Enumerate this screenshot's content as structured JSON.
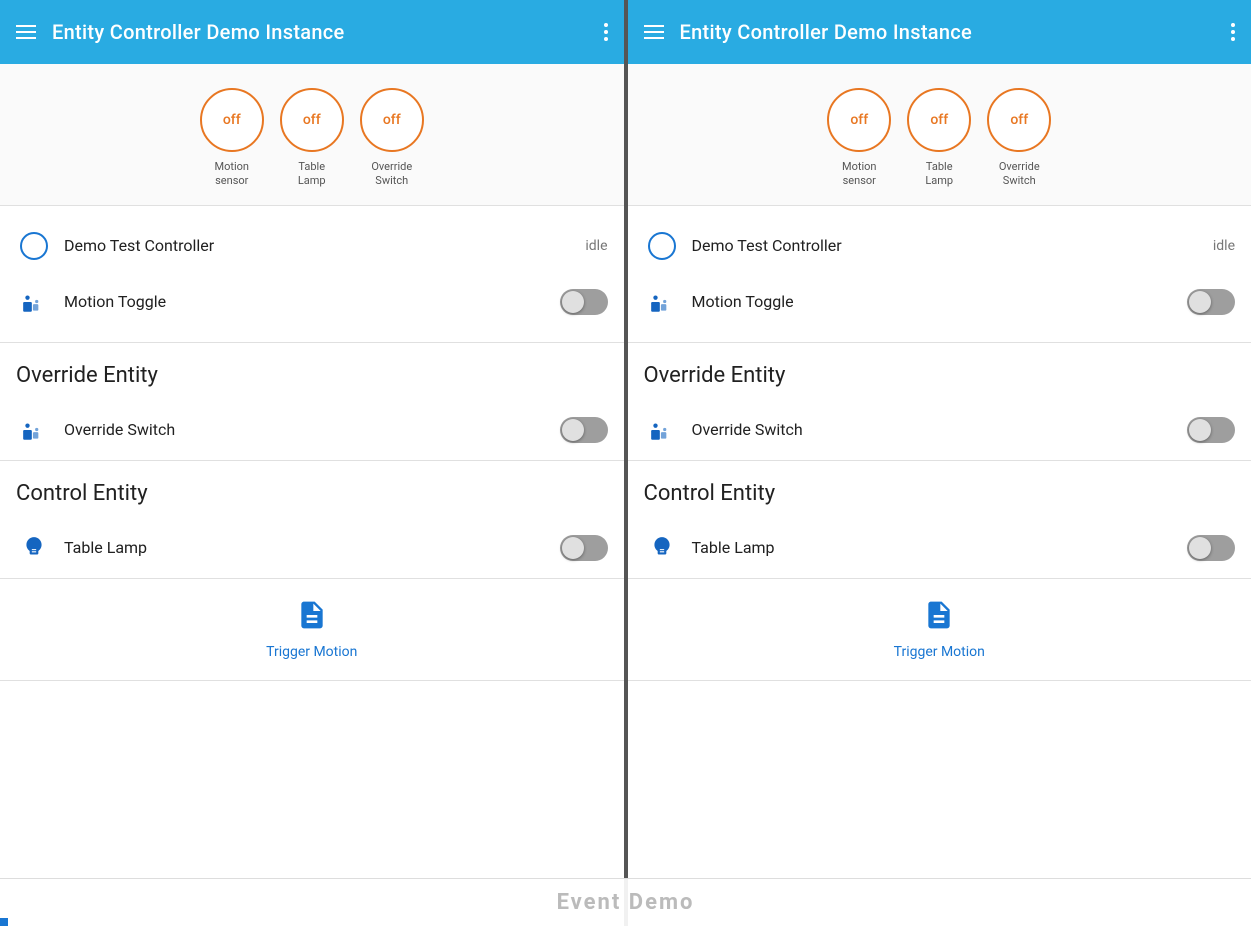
{
  "app": {
    "title": "Entity Controller Demo Instance"
  },
  "panels": [
    {
      "id": "left",
      "header": {
        "menu_label": "menu",
        "title": "Entity Controller Demo Instance",
        "more_label": "more"
      },
      "status_circles": [
        {
          "label": "off",
          "name": "Motion\nsensor"
        },
        {
          "label": "off",
          "name": "Table\nLamp"
        },
        {
          "label": "off",
          "name": "Override\nSwitch"
        }
      ],
      "controller": {
        "name": "Demo Test Controller",
        "status": "idle"
      },
      "motion_toggle": {
        "label": "Motion Toggle",
        "state": "off"
      },
      "override_entity": {
        "section_label": "Override Entity",
        "item_label": "Override Switch",
        "state": "off"
      },
      "control_entity": {
        "section_label": "Control Entity",
        "item_label": "Table Lamp",
        "state": "off"
      },
      "trigger": {
        "label": "Trigger Motion"
      }
    },
    {
      "id": "right",
      "header": {
        "menu_label": "menu",
        "title": "Entity Controller Demo Instance",
        "more_label": "more"
      },
      "status_circles": [
        {
          "label": "off",
          "name": "Motion\nsensor"
        },
        {
          "label": "off",
          "name": "Table\nLamp"
        },
        {
          "label": "off",
          "name": "Override\nSwitch"
        }
      ],
      "controller": {
        "name": "Demo Test Controller",
        "status": "idle"
      },
      "motion_toggle": {
        "label": "Motion Toggle",
        "state": "off"
      },
      "override_entity": {
        "section_label": "Override Entity",
        "item_label": "Override Switch",
        "state": "off"
      },
      "control_entity": {
        "section_label": "Control Entity",
        "item_label": "Table Lamp",
        "state": "off"
      },
      "trigger": {
        "label": "Trigger Motion"
      }
    }
  ],
  "bottom_bar": {
    "label": "Event Demo"
  },
  "colors": {
    "accent": "#29ABE2",
    "orange": "#E87722",
    "blue": "#1976d2"
  }
}
